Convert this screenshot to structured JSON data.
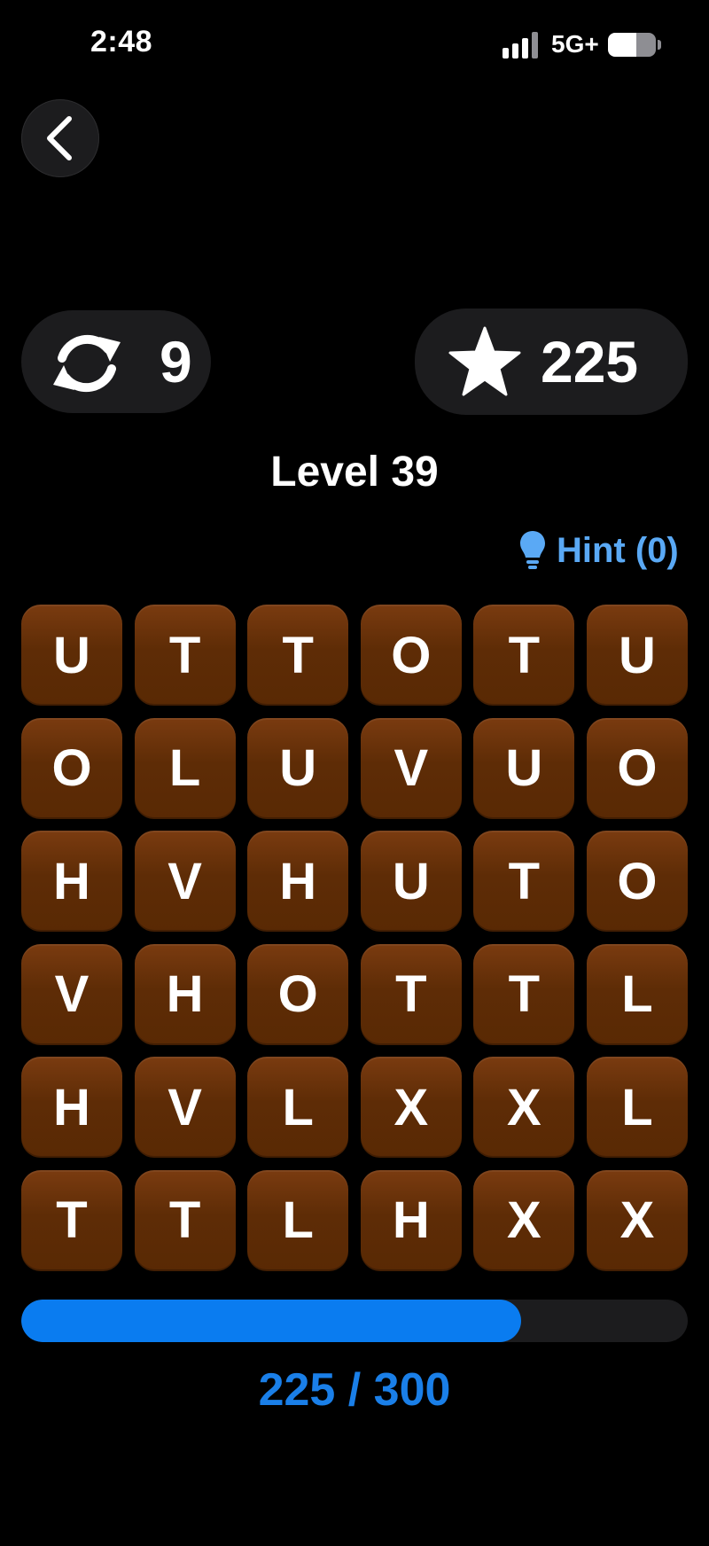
{
  "status_bar": {
    "time": "2:48",
    "network": "5G+",
    "battery_level": 0.6
  },
  "header": {
    "back_icon": "chevron-left-icon"
  },
  "stats": {
    "moves": {
      "icon": "refresh-icon",
      "value": "9"
    },
    "score": {
      "icon": "star-icon",
      "value": "225"
    }
  },
  "level": {
    "title": "Level 39"
  },
  "hint": {
    "icon": "lightbulb-icon",
    "label": "Hint (0)"
  },
  "grid": {
    "rows": [
      [
        "U",
        "T",
        "T",
        "O",
        "T",
        "U"
      ],
      [
        "O",
        "L",
        "U",
        "V",
        "U",
        "O"
      ],
      [
        "H",
        "V",
        "H",
        "U",
        "T",
        "O"
      ],
      [
        "V",
        "H",
        "O",
        "T",
        "T",
        "L"
      ],
      [
        "H",
        "V",
        "L",
        "X",
        "X",
        "L"
      ],
      [
        "T",
        "T",
        "L",
        "H",
        "X",
        "X"
      ]
    ]
  },
  "progress": {
    "current": 225,
    "target": 300,
    "label": "225 / 300"
  },
  "colors": {
    "tile": "#5e2c06",
    "accent": "#0a7cf0",
    "hint": "#5aa9f5",
    "pill": "#1c1c1e"
  }
}
